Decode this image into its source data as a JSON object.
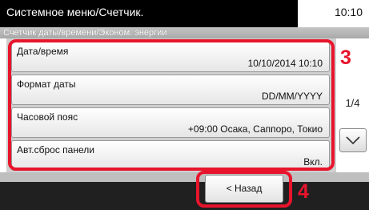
{
  "header": {
    "title": "Системное меню/Счетчик.",
    "time": "10:10",
    "subtitle": "Счетчик даты/времени/Эконом. энергии"
  },
  "items": [
    {
      "label": "Дата/время",
      "value": "10/10/2014 10:10"
    },
    {
      "label": "Формат даты",
      "value": "DD/MM/YYYY"
    },
    {
      "label": "Часовой пояс",
      "value": "+09:00 Осака, Саппоро, Токио"
    },
    {
      "label": "Авт.сброс панели",
      "value": "Вкл."
    }
  ],
  "pager": {
    "page": "1/4",
    "scroll_down_icon": "chevron-down-icon"
  },
  "footer": {
    "back_label": "< Назад"
  },
  "callouts": {
    "list": "3",
    "back": "4"
  },
  "colors": {
    "highlight": "#e8142c"
  }
}
